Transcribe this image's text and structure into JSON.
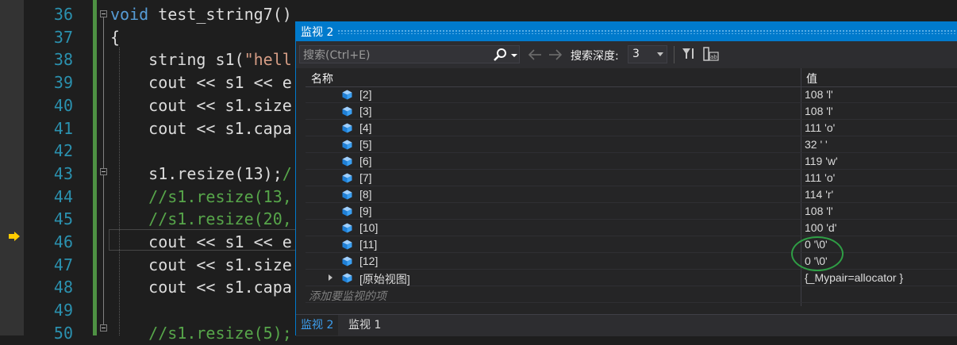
{
  "editor": {
    "lines": [
      {
        "num": "36",
        "code": [
          {
            "t": "void",
            "c": "kw"
          },
          {
            "t": " test_string7()",
            "c": ""
          }
        ]
      },
      {
        "num": "37",
        "code": [
          {
            "t": "{",
            "c": ""
          }
        ]
      },
      {
        "num": "38",
        "code": [
          {
            "t": "    string s1(",
            "c": ""
          },
          {
            "t": "\"hell",
            "c": "str"
          }
        ]
      },
      {
        "num": "39",
        "code": [
          {
            "t": "    cout << s1 << e",
            "c": ""
          }
        ]
      },
      {
        "num": "40",
        "code": [
          {
            "t": "    cout << s1.size",
            "c": ""
          }
        ]
      },
      {
        "num": "41",
        "code": [
          {
            "t": "    cout << s1.capa",
            "c": ""
          }
        ]
      },
      {
        "num": "42",
        "code": []
      },
      {
        "num": "43",
        "code": [
          {
            "t": "    s1.resize(13);",
            "c": ""
          },
          {
            "t": "/",
            "c": "cm"
          }
        ]
      },
      {
        "num": "44",
        "code": [
          {
            "t": "    //s1.resize(13,",
            "c": "cm"
          }
        ]
      },
      {
        "num": "45",
        "code": [
          {
            "t": "    //s1.resize(20,",
            "c": "cm"
          }
        ]
      },
      {
        "num": "46",
        "code": [
          {
            "t": "    cout << s1 << e",
            "c": ""
          }
        ]
      },
      {
        "num": "47",
        "code": [
          {
            "t": "    cout << s1.size",
            "c": ""
          }
        ]
      },
      {
        "num": "48",
        "code": [
          {
            "t": "    cout << s1.capa",
            "c": ""
          }
        ]
      },
      {
        "num": "49",
        "code": []
      },
      {
        "num": "50",
        "code": [
          {
            "t": "    //s1.resize(5);",
            "c": "cm"
          }
        ]
      }
    ]
  },
  "watch": {
    "title": "监视 2",
    "search_placeholder": "搜索(Ctrl+E)",
    "depth_label": "搜索深度:",
    "depth_value": "3",
    "col_name": "名称",
    "col_value": "值",
    "rows": [
      {
        "name": "[2]",
        "value": "108 'l'"
      },
      {
        "name": "[3]",
        "value": "108 'l'"
      },
      {
        "name": "[4]",
        "value": "111 'o'"
      },
      {
        "name": "[5]",
        "value": "32 ' '"
      },
      {
        "name": "[6]",
        "value": "119 'w'"
      },
      {
        "name": "[7]",
        "value": "111 'o'"
      },
      {
        "name": "[8]",
        "value": "114 'r'"
      },
      {
        "name": "[9]",
        "value": "108 'l'"
      },
      {
        "name": "[10]",
        "value": "100 'd'"
      },
      {
        "name": "[11]",
        "value": "0 '\\0'"
      },
      {
        "name": "[12]",
        "value": "0 '\\0'"
      },
      {
        "name": "[原始视图]",
        "value": "{_Mypair=allocator }"
      }
    ],
    "add_item_placeholder": "添加要监视的项",
    "tabs": [
      "监视 2",
      "监视 1"
    ]
  },
  "colors": {
    "accent": "#007acc",
    "editor_bg": "#1e1e1e",
    "keyword": "#569cd6",
    "comment": "#57a64a",
    "string": "#d69d85",
    "line_number": "#2b91af",
    "annotation_circle": "#2f9e45"
  },
  "icons": [
    "execution-arrow-icon",
    "search-icon",
    "dropdown-arrow-icon",
    "back-arrow-icon",
    "forward-arrow-icon",
    "filter-icon",
    "hex-display-icon",
    "variable-cube-icon",
    "expand-arrow-icon"
  ]
}
